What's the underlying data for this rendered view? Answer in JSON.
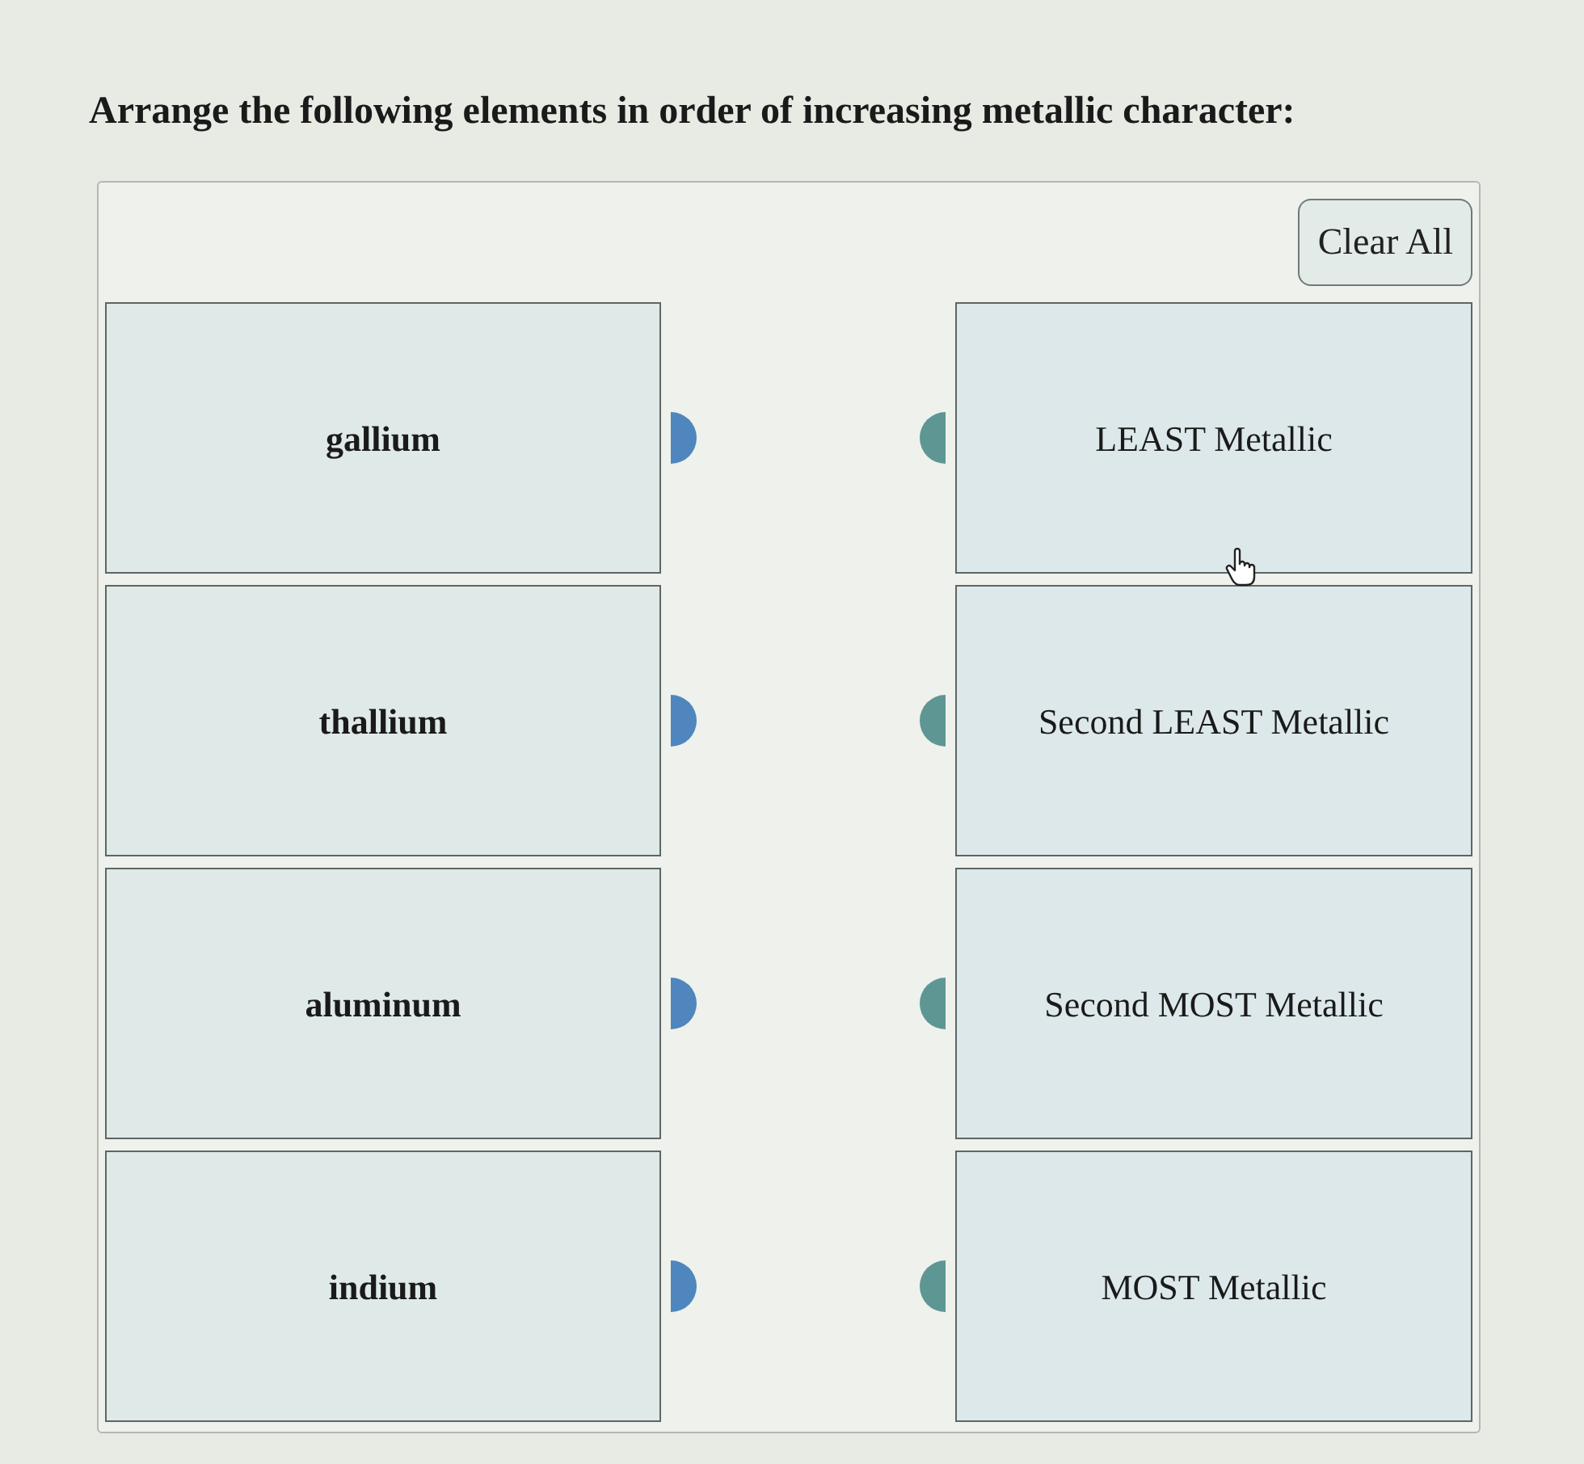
{
  "question": "Arrange the following elements in order of increasing metallic character:",
  "clear_button": "Clear All",
  "items": [
    {
      "label": "gallium"
    },
    {
      "label": "thallium"
    },
    {
      "label": "aluminum"
    },
    {
      "label": "indium"
    }
  ],
  "targets": [
    {
      "label": "LEAST Metallic"
    },
    {
      "label": "Second LEAST Metallic"
    },
    {
      "label": "Second MOST Metallic"
    },
    {
      "label": "MOST Metallic"
    }
  ]
}
